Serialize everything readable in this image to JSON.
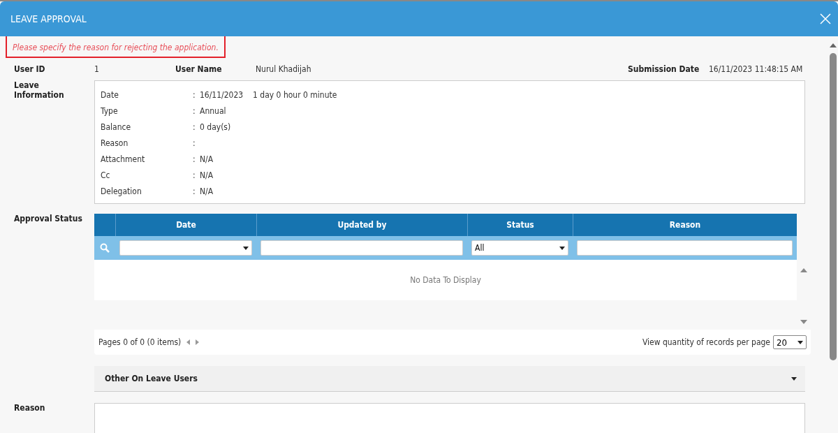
{
  "dialog": {
    "title": "LEAVE APPROVAL"
  },
  "error_message": "Please specify the reason for rejecting the application.",
  "user_id": {
    "label": "User ID",
    "value": "1"
  },
  "user_name": {
    "label": "User Name",
    "value": "Nurul Khadijah"
  },
  "submission_date": {
    "label": "Submission Date",
    "value": "16/11/2023 11:48:15 AM"
  },
  "leave_information": {
    "label": "Leave Information",
    "rows": [
      {
        "label": "Date",
        "separator": ":",
        "value": "16/11/2023",
        "extra": "1 day 0 hour 0 minute"
      },
      {
        "label": "Type",
        "separator": ":",
        "value": "Annual"
      },
      {
        "label": "Balance",
        "separator": ":",
        "value": "0 day(s)"
      },
      {
        "label": "Reason",
        "separator": ":"
      },
      {
        "label": "Attachment",
        "separator": ":",
        "value": "N/A"
      },
      {
        "label": "Cc",
        "separator": ":",
        "value": "N/A"
      },
      {
        "label": "Delegation",
        "separator": ":",
        "value": "N/A"
      }
    ]
  },
  "approval_status": {
    "label": "Approval Status",
    "columns": [
      "Date",
      "Updated by",
      "Status",
      "Reason"
    ],
    "filters": [
      {
        "kind": "dropdown"
      },
      {
        "kind": "text"
      },
      {
        "kind": "dropdown",
        "value": "All"
      },
      {
        "kind": "text"
      }
    ],
    "empty_message": "No Data To Display",
    "pager": "Pages 0 of 0 (0 items)",
    "page_size_label": "View quantity of records per page",
    "page_size": "20"
  },
  "other_on_leave_users": {
    "title": "Other On Leave Users",
    "expanded": false
  },
  "reason": {
    "label": "Reason"
  }
}
